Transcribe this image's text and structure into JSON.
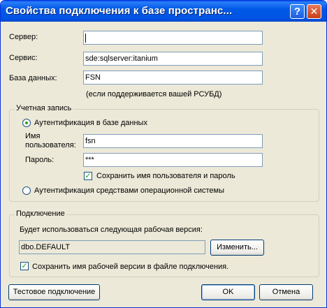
{
  "window": {
    "title": "Свойства подключения к базе пространс...",
    "help_glyph": "?",
    "close_glyph": "✕"
  },
  "fields": {
    "server_label": "Сервер:",
    "server_value": "",
    "service_label": "Сервис:",
    "service_value": "sde:sqlserver:itanium",
    "database_label": "База данных:",
    "database_value": "FSN",
    "database_hint": "(если поддерживается вашей РСУБД)"
  },
  "account": {
    "legend": "Учетная запись",
    "db_auth_label": "Аутентификация в базе данных",
    "db_auth_selected": true,
    "username_label_line1": "Имя",
    "username_label_line2": "пользователя:",
    "username_value": "fsn",
    "password_label": "Пароль:",
    "password_value": "***",
    "save_credentials_label": "Сохранить имя пользователя и пароль",
    "save_credentials_checked": true,
    "os_auth_label": "Аутентификация средствами операционной системы",
    "os_auth_selected": false
  },
  "connection": {
    "legend": "Подключение",
    "version_caption": "Будет использоваться следующая рабочая версия:",
    "version_value": "dbo.DEFAULT",
    "change_button": "Изменить...",
    "save_version_label": "Сохранить имя рабочей версии в файле подключения.",
    "save_version_checked": true
  },
  "buttons": {
    "test": "Тестовое подключение",
    "ok": "OK",
    "cancel": "Отмена"
  },
  "colors": {
    "titlebar": "#0054e3",
    "dialog_bg": "#ece9d8",
    "input_border": "#7f9db9",
    "check_mark": "#21a121"
  }
}
